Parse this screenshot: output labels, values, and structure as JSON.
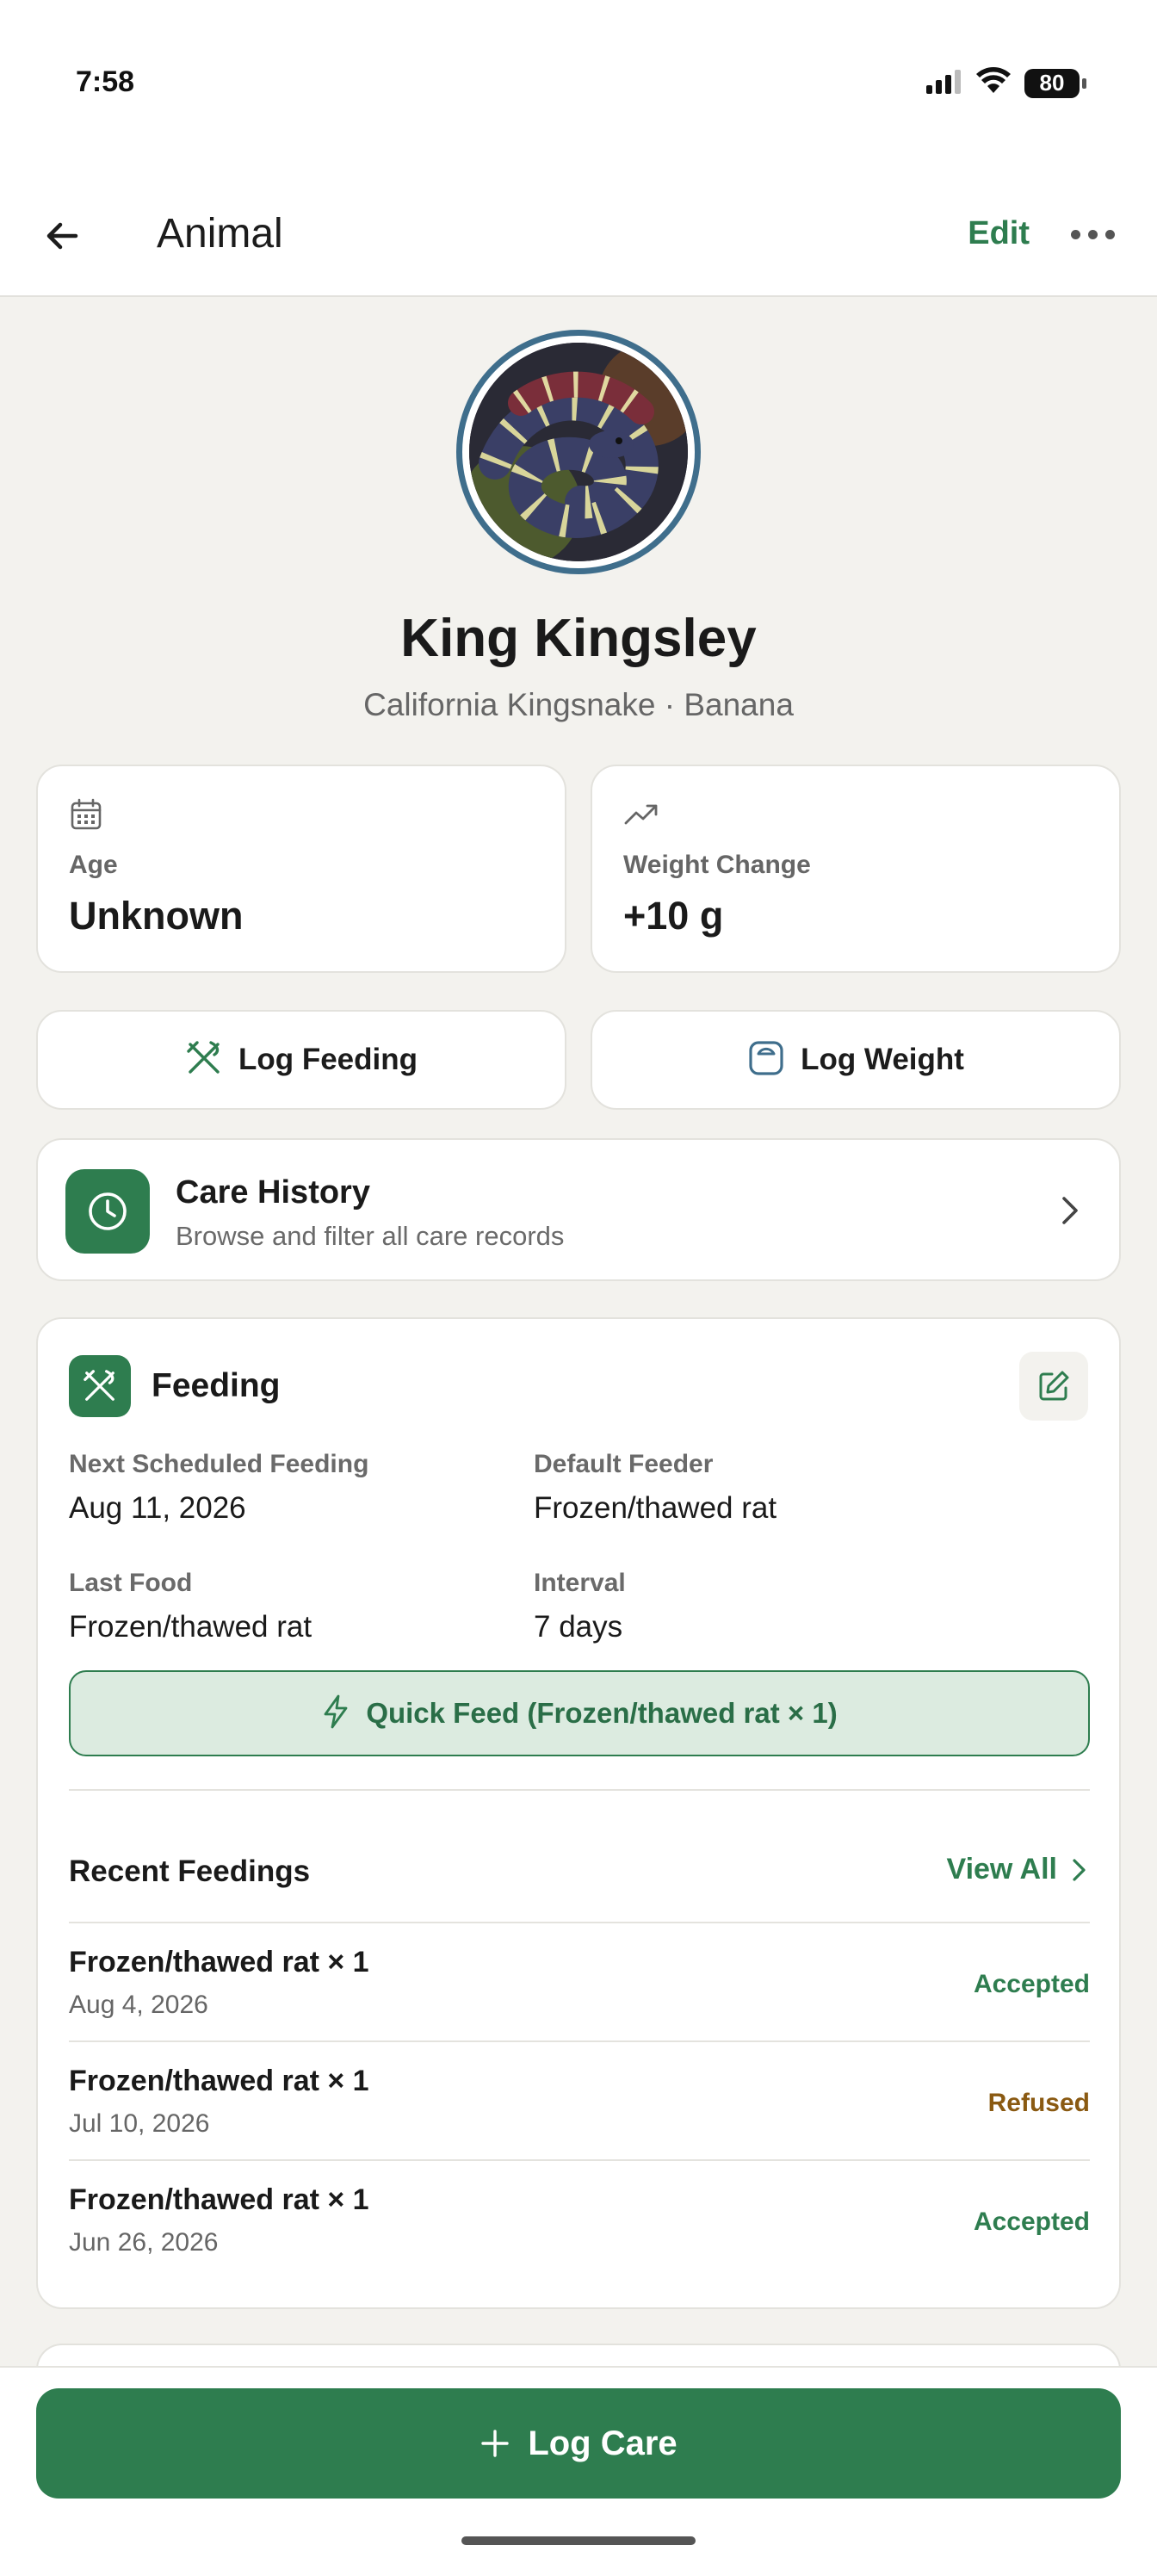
{
  "status_bar": {
    "time": "7:58",
    "battery": "80"
  },
  "app_bar": {
    "title": "Animal",
    "edit_label": "Edit"
  },
  "profile": {
    "name": "King Kingsley",
    "subtitle": "California Kingsnake · Banana"
  },
  "stats": {
    "age": {
      "label": "Age",
      "value": "Unknown",
      "icon": "calendar-icon"
    },
    "weight_change": {
      "label": "Weight Change",
      "value": "+10 g",
      "icon": "trending-up-icon"
    }
  },
  "actions": {
    "log_feeding": "Log Feeding",
    "log_weight": "Log Weight"
  },
  "care_history": {
    "title": "Care History",
    "subtitle": "Browse and filter all care records"
  },
  "feeding": {
    "title": "Feeding",
    "fields": {
      "next_scheduled": {
        "label": "Next Scheduled Feeding",
        "value": "Aug 11, 2026"
      },
      "default_feeder": {
        "label": "Default Feeder",
        "value": "Frozen/thawed rat"
      },
      "last_food": {
        "label": "Last Food",
        "value": "Frozen/thawed rat"
      },
      "interval": {
        "label": "Interval",
        "value": "7 days"
      }
    },
    "quick_feed_label": "Quick Feed (Frozen/thawed rat × 1)",
    "recent_title": "Recent Feedings",
    "view_all_label": "View All",
    "recent": [
      {
        "name": "Frozen/thawed rat × 1",
        "date": "Aug 4, 2026",
        "status": "Accepted"
      },
      {
        "name": "Frozen/thawed rat × 1",
        "date": "Jul 10, 2026",
        "status": "Refused"
      },
      {
        "name": "Frozen/thawed rat × 1",
        "date": "Jun 26, 2026",
        "status": "Accepted"
      }
    ]
  },
  "bottom": {
    "log_care_label": "Log Care"
  },
  "colors": {
    "accent": "#2e7d4f",
    "refused": "#8a5a12",
    "background": "#f3f2ee",
    "avatar_ring": "#3f6e8c"
  }
}
